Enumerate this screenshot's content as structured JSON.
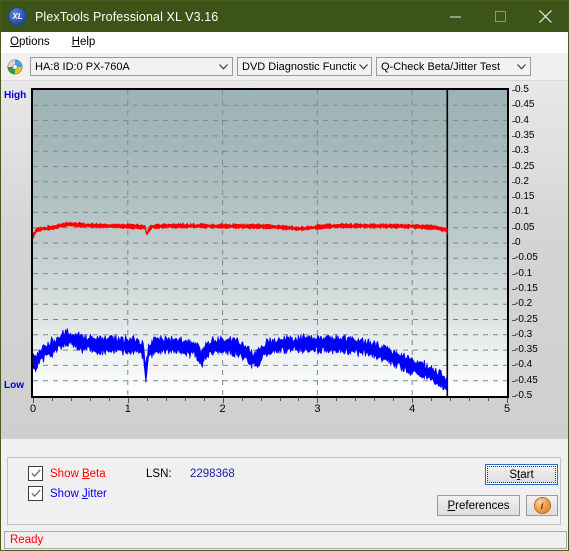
{
  "window": {
    "title": "PlexTools Professional XL V3.16",
    "logo_text": "XL",
    "minimize_icon": "minimize-icon",
    "maximize_icon": "maximize-icon",
    "close_icon": "close-icon",
    "titlebar_color": "#3c5418"
  },
  "menubar": {
    "items": [
      {
        "label": "Options",
        "accel": "O"
      },
      {
        "label": "Help",
        "accel": "H"
      }
    ]
  },
  "toolbar": {
    "disc_icon": "disc-icon",
    "drive": {
      "value": "HA:8 ID:0  PX-760A"
    },
    "function": {
      "value": "DVD Diagnostic Functions"
    },
    "test": {
      "value": "Q-Check Beta/Jitter Test"
    }
  },
  "chart_panel": {
    "label_high": "High",
    "label_low": "Low"
  },
  "options": {
    "show_beta": {
      "label_pre": "Show ",
      "accel": "B",
      "label_post": "eta",
      "checked": true,
      "color": "#ff0000"
    },
    "show_jitter": {
      "label_pre": "Show ",
      "accel": "J",
      "label_post": "itter",
      "checked": true,
      "color": "#0000ff"
    },
    "lsn_label": "LSN:",
    "lsn_value": "2298368",
    "start_button": {
      "label_pre": "S",
      "accel": "t",
      "label_post": "art"
    },
    "preferences_button": {
      "label_pre": "",
      "accel": "P",
      "label_post": "references"
    },
    "info_button": {
      "icon": "info-icon",
      "glyph": "i"
    }
  },
  "statusbar": {
    "text": "Ready"
  },
  "chart_data": {
    "type": "line",
    "title": "Q-Check Beta/Jitter Test",
    "xlabel": "",
    "ylabel": "",
    "xlim": [
      0,
      5
    ],
    "ylim": [
      -0.5,
      0.5
    ],
    "grid": true,
    "x_ticks": [
      0,
      1,
      2,
      3,
      4,
      5
    ],
    "y_ticks": [
      0.5,
      0.45,
      0.4,
      0.35,
      0.3,
      0.25,
      0.2,
      0.15,
      0.1,
      0.05,
      0,
      -0.05,
      -0.1,
      -0.15,
      -0.2,
      -0.25,
      -0.3,
      -0.35,
      -0.4,
      -0.45,
      -0.5
    ],
    "axis_top_label": "High",
    "axis_bottom_label": "Low",
    "data_end_marker_x": 4.37,
    "series": [
      {
        "name": "Beta",
        "color": "#ff0000",
        "noise": 0.006,
        "x": [
          0.0,
          0.03,
          0.06,
          0.1,
          0.15,
          0.22,
          0.3,
          0.38,
          0.45,
          0.55,
          0.7,
          0.85,
          1.0,
          1.13,
          1.18,
          1.2,
          1.24,
          1.35,
          1.55,
          1.75,
          1.95,
          2.15,
          2.4,
          2.6,
          2.75,
          2.85,
          2.95,
          3.1,
          3.35,
          3.6,
          3.9,
          4.1,
          4.25,
          4.32,
          4.37
        ],
        "y": [
          0.02,
          0.04,
          0.045,
          0.046,
          0.048,
          0.05,
          0.058,
          0.062,
          0.06,
          0.058,
          0.057,
          0.056,
          0.055,
          0.053,
          0.052,
          0.03,
          0.052,
          0.055,
          0.056,
          0.056,
          0.055,
          0.055,
          0.054,
          0.052,
          0.048,
          0.046,
          0.05,
          0.055,
          0.056,
          0.056,
          0.055,
          0.053,
          0.05,
          0.045,
          0.04
        ]
      },
      {
        "name": "Jitter",
        "color": "#0000ff",
        "noise": 0.022,
        "x": [
          0.0,
          0.03,
          0.07,
          0.12,
          0.18,
          0.25,
          0.32,
          0.38,
          0.44,
          0.5,
          0.6,
          0.72,
          0.85,
          1.0,
          1.1,
          1.16,
          1.19,
          1.22,
          1.28,
          1.4,
          1.55,
          1.7,
          1.78,
          1.82,
          1.88,
          2.0,
          2.15,
          2.25,
          2.32,
          2.38,
          2.45,
          2.55,
          2.7,
          2.9,
          3.1,
          3.3,
          3.45,
          3.6,
          3.72,
          3.82,
          3.92,
          4.0,
          4.08,
          4.15,
          4.22,
          4.28,
          4.33,
          4.37
        ],
        "y": [
          -0.38,
          -0.4,
          -0.37,
          -0.355,
          -0.345,
          -0.33,
          -0.315,
          -0.31,
          -0.318,
          -0.325,
          -0.33,
          -0.332,
          -0.333,
          -0.334,
          -0.336,
          -0.345,
          -0.43,
          -0.35,
          -0.336,
          -0.334,
          -0.336,
          -0.345,
          -0.375,
          -0.352,
          -0.338,
          -0.334,
          -0.34,
          -0.36,
          -0.385,
          -0.372,
          -0.348,
          -0.336,
          -0.332,
          -0.33,
          -0.331,
          -0.333,
          -0.338,
          -0.348,
          -0.362,
          -0.378,
          -0.392,
          -0.405,
          -0.412,
          -0.42,
          -0.432,
          -0.442,
          -0.455,
          -0.468
        ]
      }
    ]
  }
}
